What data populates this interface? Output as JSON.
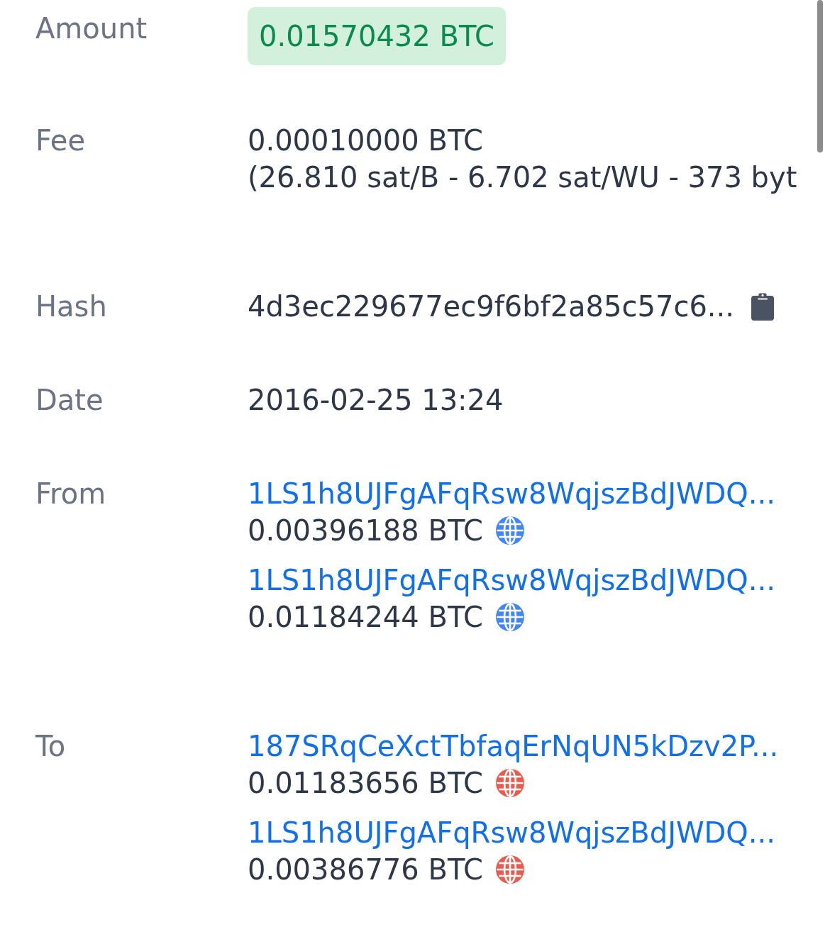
{
  "rows": [
    {
      "kind": "badge",
      "label": "Amount",
      "value": "0.01570432 BTC"
    },
    {
      "kind": "lines",
      "label": "Fee",
      "lines": [
        "0.00010000 BTC",
        "(26.810 sat/B - 6.702 sat/WU - 373 byt"
      ]
    },
    {
      "kind": "copy",
      "label": "Hash",
      "value": "4d3ec229677ec9f6bf2a85c57c6..."
    },
    {
      "kind": "text",
      "label": "Date",
      "value": "2016-02-25 13:24"
    },
    {
      "kind": "io",
      "label": "From",
      "color": "#4285f4",
      "entries": [
        {
          "address": "1LS1h8UJFgAFqRsw8WqjszBdJWDQ...",
          "amount": "0.00396188 BTC"
        },
        {
          "address": "1LS1h8UJFgAFqRsw8WqjszBdJWDQ...",
          "amount": "0.01184244 BTC"
        }
      ]
    },
    {
      "kind": "io",
      "label": "To",
      "color": "#ea5a4f",
      "entries": [
        {
          "address": "187SRqCeXctTbfaqErNqUN5kDzv2P...",
          "amount": "0.01183656 BTC"
        },
        {
          "address": "1LS1h8UJFgAFqRsw8WqjszBdJWDQ...",
          "amount": "0.00386776 BTC"
        }
      ]
    }
  ]
}
